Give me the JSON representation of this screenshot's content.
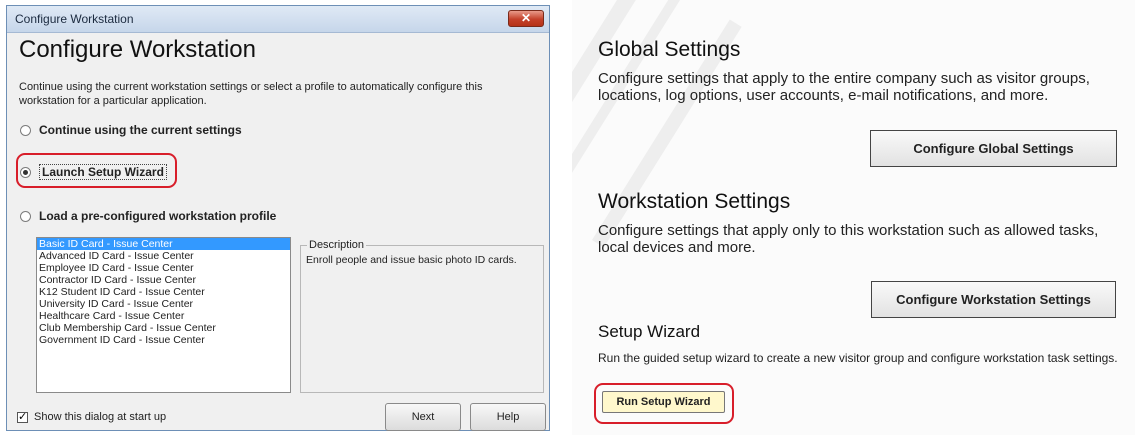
{
  "dialog": {
    "window_title": "Configure Workstation",
    "close_symbol": "✕",
    "heading": "Configure Workstation",
    "description": "Continue using the current workstation settings or select a profile to automatically configure this workstation for a particular application.",
    "options": {
      "continue": "Continue using the current settings",
      "wizard": "Launch Setup Wizard",
      "profile": "Load a pre-configured workstation profile"
    },
    "selected_option": "wizard",
    "profiles": [
      "Basic ID Card - Issue Center",
      "Advanced ID Card - Issue Center",
      "Employee ID Card - Issue Center",
      "Contractor ID Card - Issue Center",
      "K12 Student ID Card - Issue Center",
      "University ID Card - Issue Center",
      "Healthcare Card - Issue Center",
      "Club Membership Card - Issue Center",
      "Government ID Card - Issue Center"
    ],
    "selected_profile_index": 0,
    "description_box": {
      "legend": "Description",
      "text": "Enroll people and issue basic photo ID cards."
    },
    "show_at_startup_label": "Show this dialog at start up",
    "show_at_startup_checked": true,
    "next_label": "Next",
    "help_label": "Help"
  },
  "settings": {
    "global": {
      "heading": "Global Settings",
      "description": "Configure settings that apply to the entire company such as visitor groups, locations, log options, user accounts, e-mail notifications, and more.",
      "button": "Configure Global Settings"
    },
    "workstation": {
      "heading": "Workstation Settings",
      "description": "Configure settings that apply only to this workstation such as allowed tasks, local devices and more.",
      "button": "Configure Workstation Settings"
    },
    "setup_wizard": {
      "heading": "Setup Wizard",
      "description": "Run the guided setup wizard to create a new visitor group and configure workstation task settings.",
      "button": "Run Setup Wizard"
    }
  },
  "colors": {
    "highlight": "#d81e2a",
    "list_selection": "#3399ff",
    "wizard_button_bg": "#fff8cc"
  }
}
